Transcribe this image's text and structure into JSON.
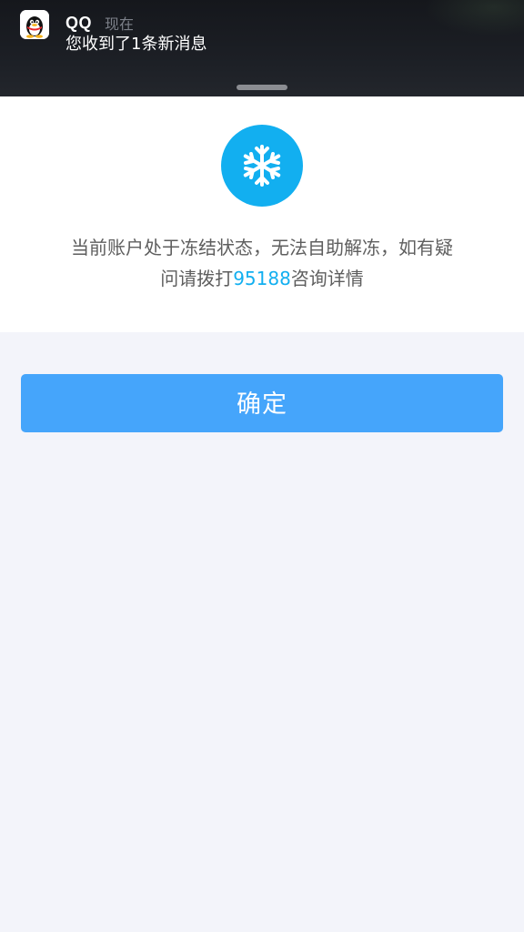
{
  "notification": {
    "app_name": "QQ",
    "time": "现在",
    "message": "您收到了1条新消息",
    "icon": "qq-penguin-icon"
  },
  "dialog": {
    "icon": "snowflake-icon",
    "icon_color": "#12aff0",
    "message_part1": "当前账户处于冻结状态，无法自助解冻，如有疑",
    "message_part2": "问请拨打",
    "phone": "95188",
    "message_part3": "咨询详情"
  },
  "confirm_button": {
    "label": "确定",
    "color": "#45a5fb"
  }
}
